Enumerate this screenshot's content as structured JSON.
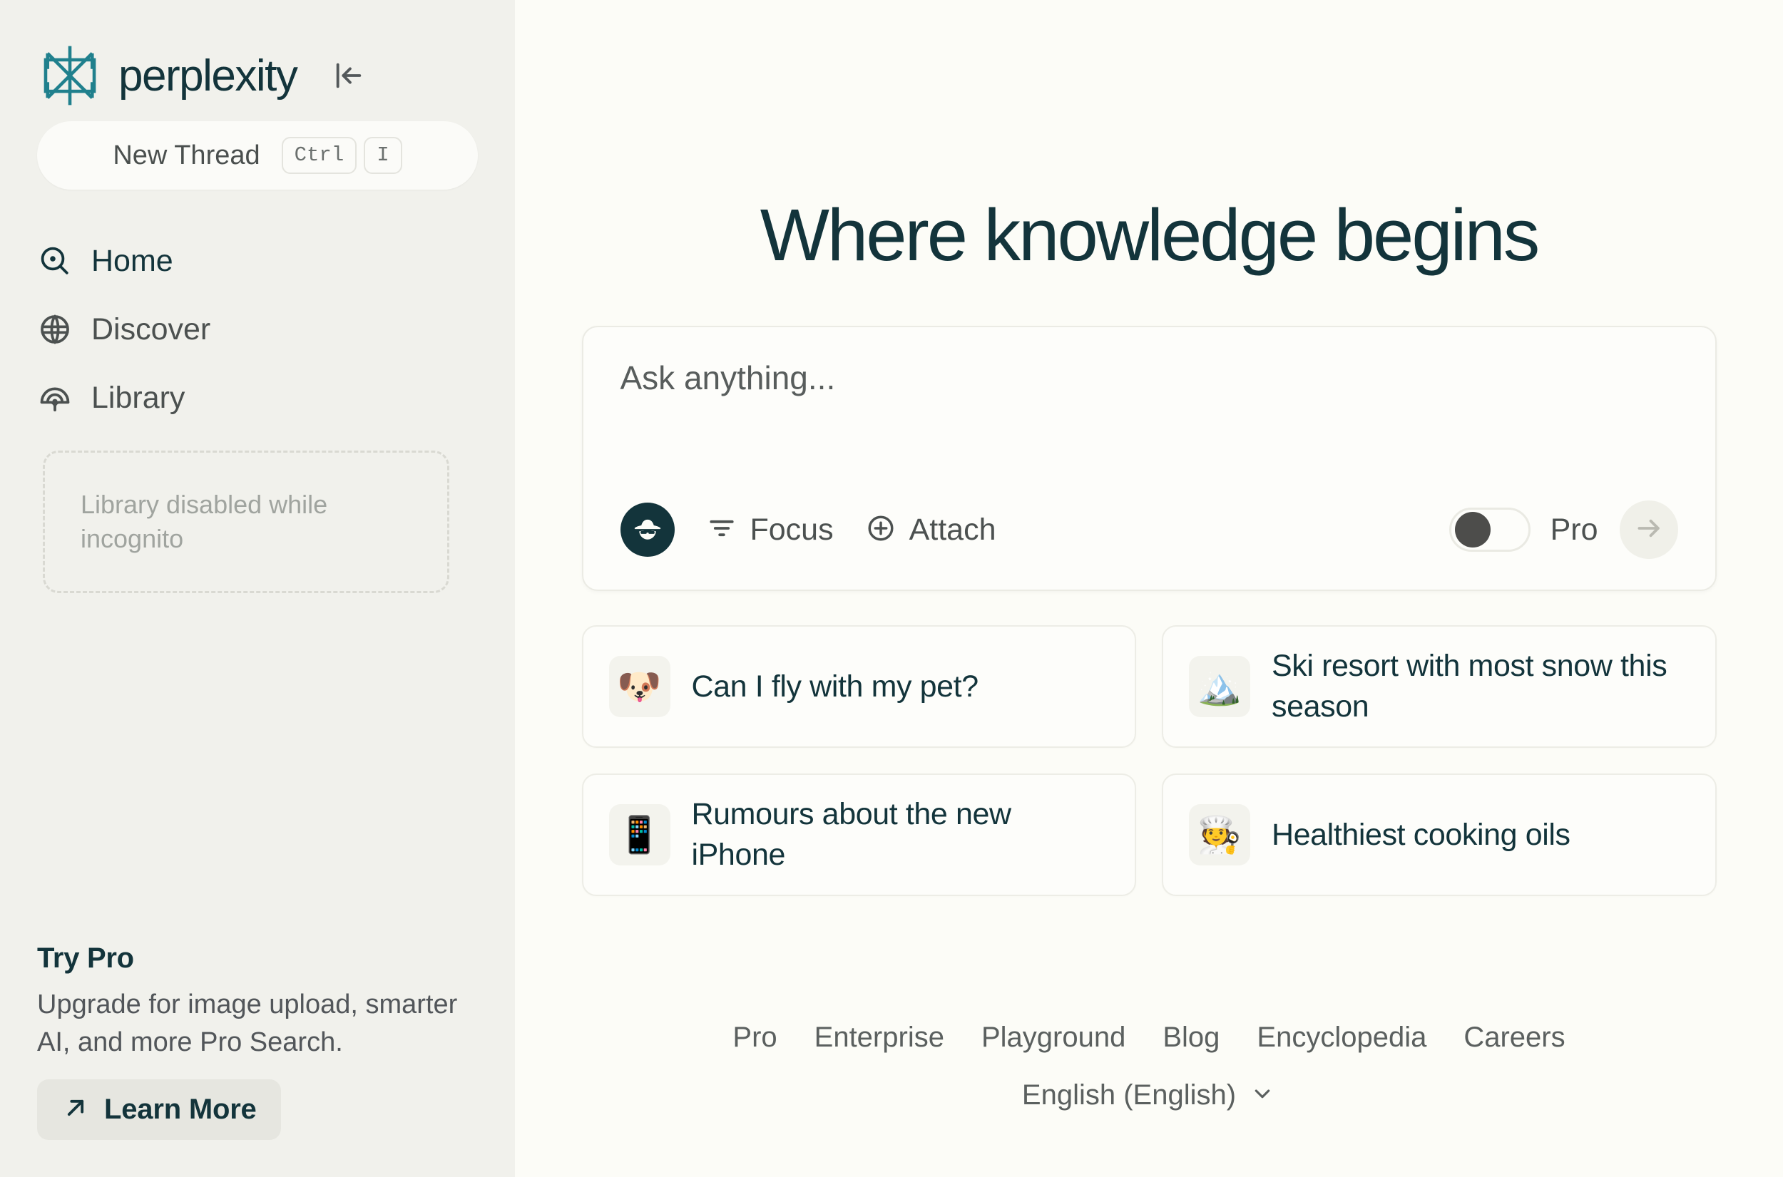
{
  "brand": {
    "name": "perplexity",
    "logo_icon": "perplexity-logo-icon",
    "logo_color": "#20808d",
    "wordmark_color": "#13343b"
  },
  "sidebar": {
    "collapse_icon": "collapse-sidebar-icon",
    "new_thread": {
      "label": "New Thread",
      "shortcut_keys": [
        "Ctrl",
        "I"
      ]
    },
    "items": [
      {
        "label": "Home",
        "icon": "search-target-icon",
        "active": true
      },
      {
        "label": "Discover",
        "icon": "globe-icon",
        "active": false
      },
      {
        "label": "Library",
        "icon": "library-book-icon",
        "active": false
      }
    ],
    "library_disabled_notice": "Library disabled while incognito",
    "try_pro": {
      "title": "Try Pro",
      "body": "Upgrade for image upload, smarter AI, and more Pro Search.",
      "cta_label": "Learn More",
      "cta_icon": "arrow-up-right-icon"
    }
  },
  "main": {
    "headline": "Where knowledge begins",
    "ask": {
      "placeholder": "Ask anything...",
      "value": "",
      "incognito_icon": "incognito-hat-icon",
      "focus_label": "Focus",
      "focus_icon": "filter-lines-icon",
      "attach_label": "Attach",
      "attach_icon": "plus-circle-icon",
      "pro_label": "Pro",
      "pro_enabled": false,
      "submit_icon": "arrow-right-icon"
    },
    "suggestions": [
      {
        "emoji": "🐶",
        "emoji_name": "dog-face-emoji",
        "text": "Can I fly with my pet?"
      },
      {
        "emoji": "🏔️",
        "emoji_name": "snow-capped-mountain-emoji",
        "text": "Ski resort with most snow this season"
      },
      {
        "emoji": "📱",
        "emoji_name": "mobile-phone-emoji",
        "text": "Rumours about the new iPhone"
      },
      {
        "emoji": "🧑‍🍳",
        "emoji_name": "cook-emoji",
        "text": "Healthiest cooking oils"
      }
    ]
  },
  "footer": {
    "links": [
      "Pro",
      "Enterprise",
      "Playground",
      "Blog",
      "Encyclopedia",
      "Careers"
    ],
    "language": "English (English)",
    "language_chevron_icon": "chevron-down-icon"
  }
}
